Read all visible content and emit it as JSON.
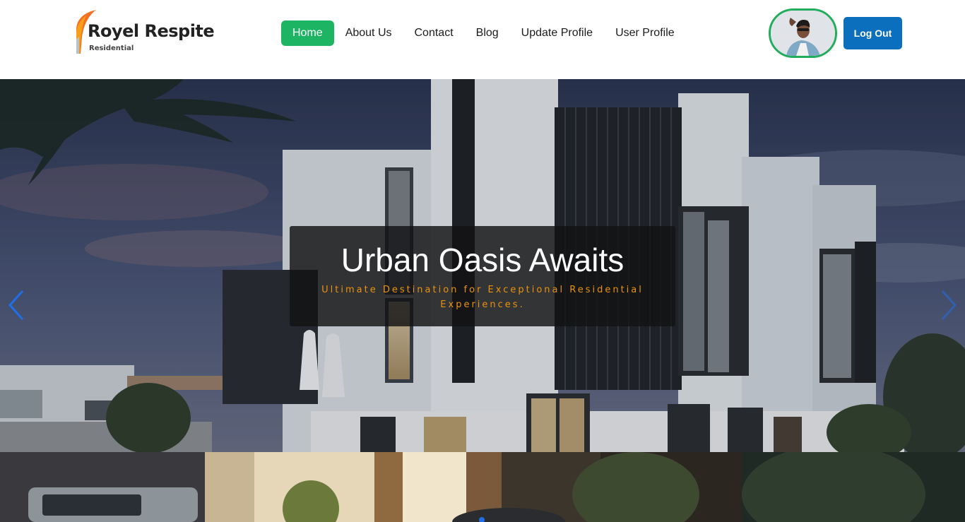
{
  "brand": {
    "name": "Royel Respite",
    "subtitle": "Residential"
  },
  "nav": {
    "items": [
      {
        "label": "Home",
        "active": true
      },
      {
        "label": "About Us",
        "active": false
      },
      {
        "label": "Contact",
        "active": false
      },
      {
        "label": "Blog",
        "active": false
      },
      {
        "label": "Update Profile",
        "active": false
      },
      {
        "label": "User Profile",
        "active": false
      }
    ]
  },
  "user": {
    "avatar_icon": "user-avatar-photo",
    "logout_label": "Log Out"
  },
  "hero": {
    "title": "Urban Oasis Awaits",
    "subtitle": "Ultimate Destination for Exceptional Residential Experiences.",
    "prev_icon": "chevron-left-icon",
    "next_icon": "chevron-right-icon"
  },
  "colors": {
    "accent_green": "#1db464",
    "logout_blue": "#0b6fbd",
    "subtitle_orange": "#e9920f",
    "arrow_blue": "#1e6fe8"
  }
}
